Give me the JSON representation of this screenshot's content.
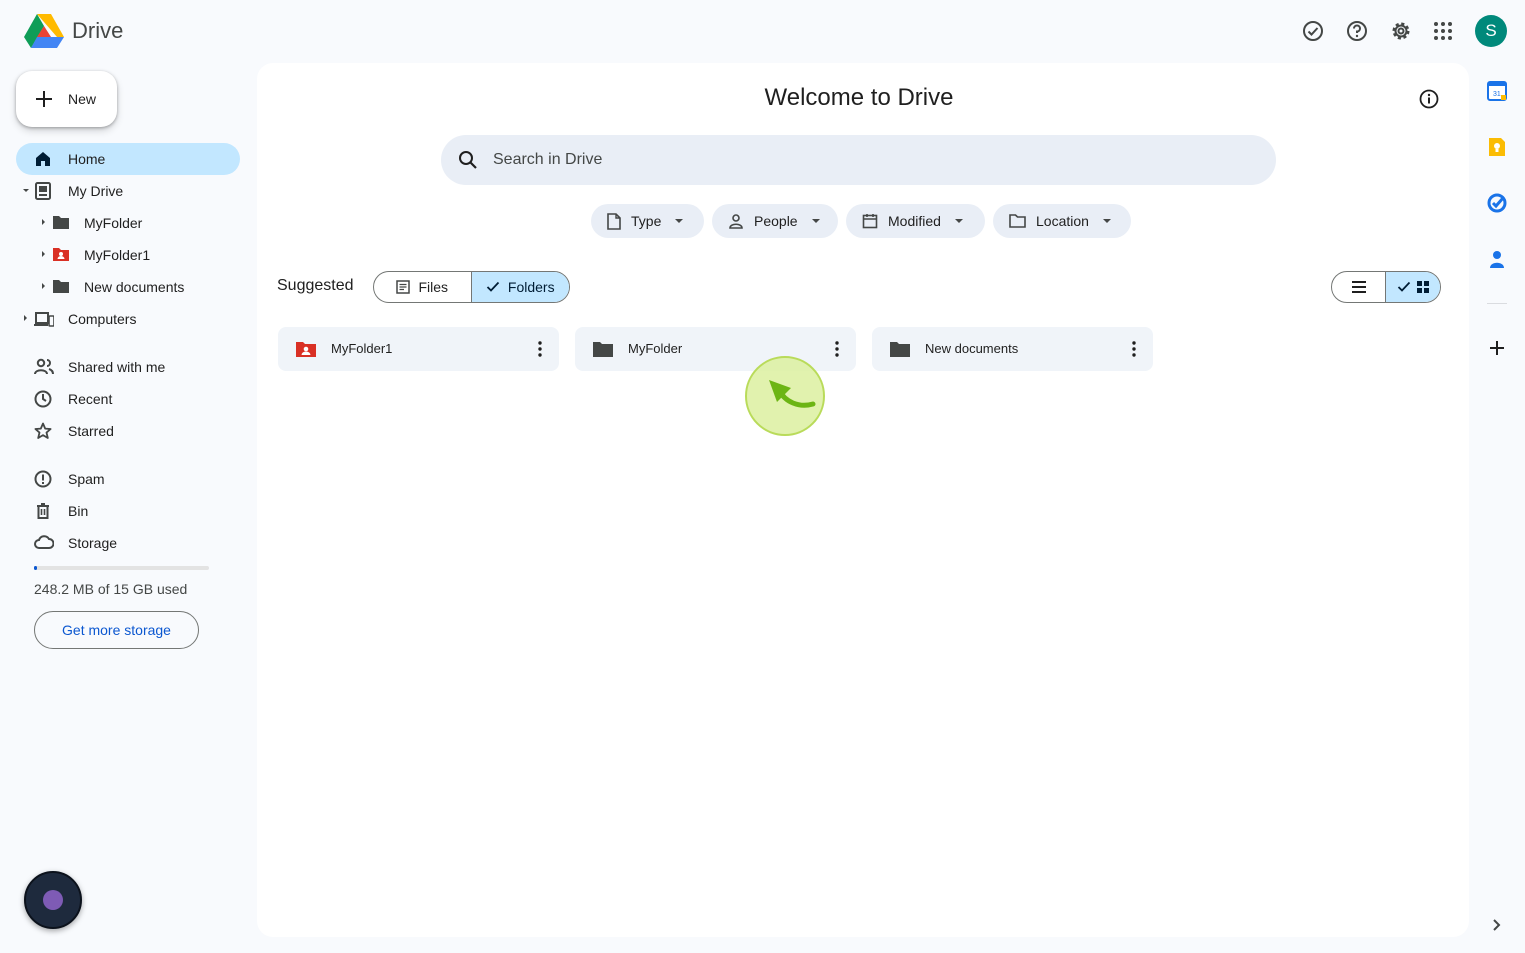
{
  "app": {
    "title": "Drive"
  },
  "header": {
    "avatar_letter": "S"
  },
  "new_button": {
    "label": "New"
  },
  "sidebar": {
    "items": [
      {
        "label": "Home"
      },
      {
        "label": "My Drive"
      },
      {
        "label": "MyFolder"
      },
      {
        "label": "MyFolder1"
      },
      {
        "label": "New documents"
      },
      {
        "label": "Computers"
      },
      {
        "label": "Shared with me"
      },
      {
        "label": "Recent"
      },
      {
        "label": "Starred"
      },
      {
        "label": "Spam"
      },
      {
        "label": "Bin"
      },
      {
        "label": "Storage"
      }
    ],
    "storage": {
      "text": "248.2 MB of 15 GB used",
      "used_fraction": 0.016,
      "button": "Get more storage"
    }
  },
  "main": {
    "title": "Welcome to Drive",
    "search": {
      "placeholder": "Search in Drive"
    },
    "filters": [
      {
        "label": "Type"
      },
      {
        "label": "People"
      },
      {
        "label": "Modified"
      },
      {
        "label": "Location"
      }
    ],
    "suggested_label": "Suggested",
    "segments": {
      "files": "Files",
      "folders": "Folders"
    },
    "folders": [
      {
        "name": "MyFolder1",
        "shared": true
      },
      {
        "name": "MyFolder",
        "shared": false
      },
      {
        "name": "New documents",
        "shared": false
      }
    ]
  },
  "colors": {
    "accent": "#c2e7ff",
    "primary": "#0b57d0",
    "shared_folder": "#d93025",
    "folder": "#444746",
    "avatar": "#00897b"
  }
}
